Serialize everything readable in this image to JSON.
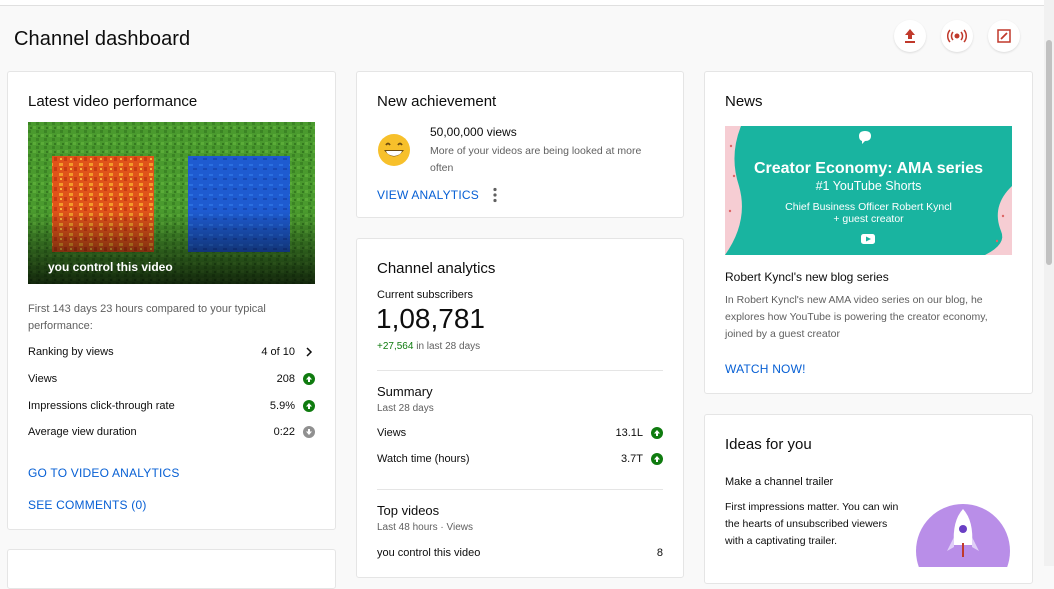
{
  "page": {
    "title": "Channel dashboard"
  },
  "header_actions": {
    "upload_icon": "upload-icon",
    "live_icon": "live-icon",
    "create_post_icon": "create-post-icon"
  },
  "latest_video": {
    "title": "Latest video performance",
    "thumbnail_caption": "you control this video",
    "comparison_text": "First 143 days 23 hours compared to your typical performance:",
    "rows": [
      {
        "label": "Ranking by views",
        "value": "4 of 10",
        "indicator": "chevron-right"
      },
      {
        "label": "Views",
        "value": "208",
        "indicator": "up"
      },
      {
        "label": "Impressions click-through rate",
        "value": "5.9%",
        "indicator": "up"
      },
      {
        "label": "Average view duration",
        "value": "0:22",
        "indicator": "neutral"
      }
    ],
    "go_to_analytics": "GO TO VIDEO ANALYTICS",
    "see_comments": "SEE COMMENTS (0)"
  },
  "achievement": {
    "title": "New achievement",
    "headline": "50,00,000 views",
    "description": "More of your videos are being looked at more often",
    "view_analytics": "VIEW ANALYTICS"
  },
  "channel_analytics": {
    "title": "Channel analytics",
    "subscribers_label": "Current subscribers",
    "subscribers_value": "1,08,781",
    "subscribers_change": "+27,564",
    "subscribers_change_suffix": " in last 28 days",
    "summary_title": "Summary",
    "summary_period": "Last 28 days",
    "summary_rows": [
      {
        "label": "Views",
        "value": "13.1L",
        "indicator": "up"
      },
      {
        "label": "Watch time (hours)",
        "value": "3.7T",
        "indicator": "up"
      }
    ],
    "top_videos_title": "Top videos",
    "top_videos_period": "Last 48 hours · Views",
    "top_videos": [
      {
        "label": "you control this video",
        "value": "8"
      }
    ]
  },
  "news": {
    "title": "News",
    "banner_title": "Creator Economy: AMA series",
    "banner_subtitle": "#1 YouTube Shorts",
    "banner_line1": "Chief Business Officer Robert Kyncl",
    "banner_line2": "+ guest creator",
    "article_title": "Robert Kyncl's new blog series",
    "article_text": "In Robert Kyncl's new AMA video series on our blog, he explores how YouTube is powering the creator economy, joined by a guest creator",
    "watch_now": "WATCH NOW!"
  },
  "ideas": {
    "title": "Ideas for you",
    "item_title": "Make a channel trailer",
    "item_text": "First impressions matter. You can win the hearts of unsubscribed viewers with a captivating trailer."
  },
  "colors": {
    "link": "#065fd4",
    "positive": "#0f7b0f",
    "banner_teal": "#19b4a0"
  }
}
